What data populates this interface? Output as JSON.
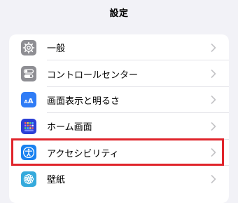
{
  "nav": {
    "title": "設定"
  },
  "settings": {
    "items": [
      {
        "label": "一般",
        "icon": "gear-icon",
        "icon_color": "#8e8e93"
      },
      {
        "label": "コントロールセンター",
        "icon": "toggles-icon",
        "icon_color": "#8e8e93"
      },
      {
        "label": "画面表示と明るさ",
        "icon": "display-brightness-icon",
        "icon_color": "#2f7cf6",
        "icon_text": "AA"
      },
      {
        "label": "ホーム画面",
        "icon": "home-screen-icon",
        "icon_color": "#2b3fd6"
      },
      {
        "label": "アクセシビリティ",
        "icon": "accessibility-icon",
        "icon_color": "#1a82f0"
      },
      {
        "label": "壁紙",
        "icon": "wallpaper-icon",
        "icon_color": "#35aadc"
      }
    ]
  },
  "highlight": {
    "target": "アクセシビリティ",
    "color": "#e0242b"
  }
}
